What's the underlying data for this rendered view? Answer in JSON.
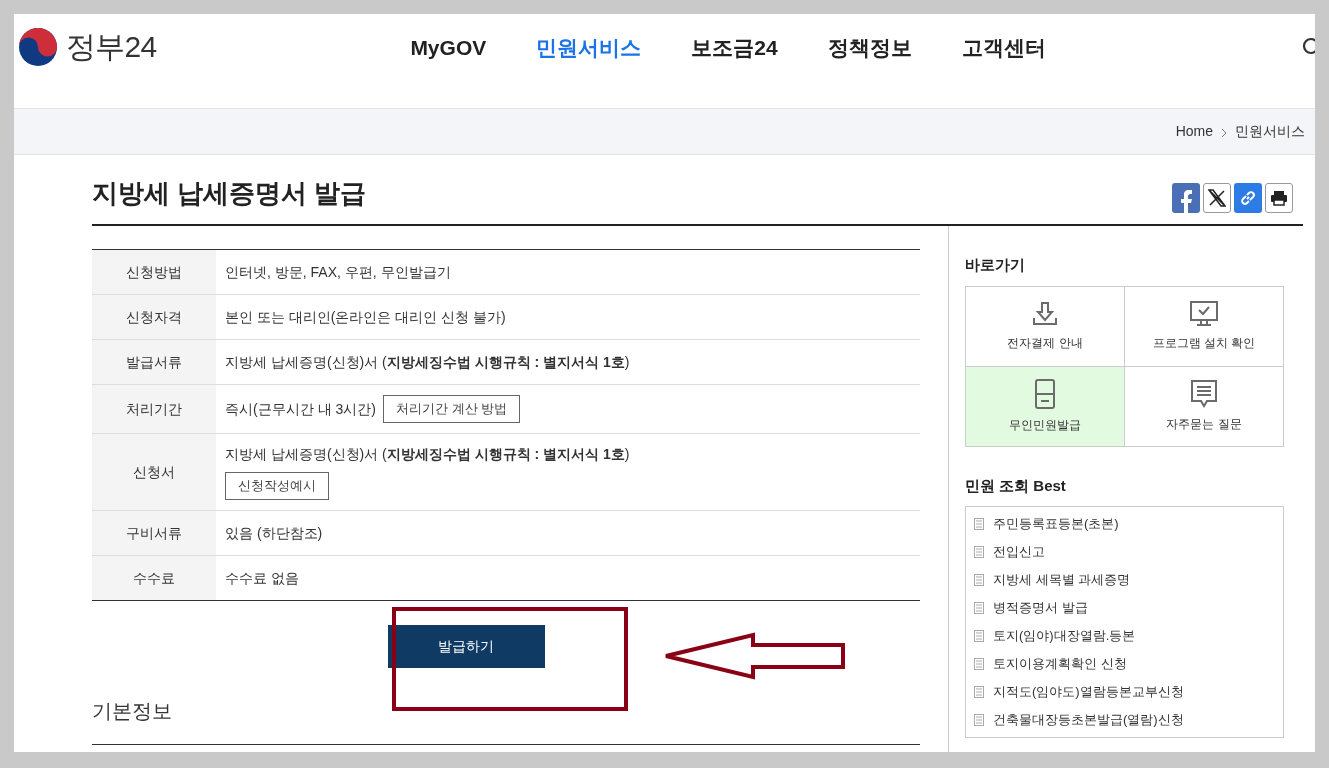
{
  "logo": {
    "text": "정부24"
  },
  "nav": [
    {
      "label": "MyGOV",
      "selected": false
    },
    {
      "label": "민원서비스",
      "selected": true
    },
    {
      "label": "보조금24",
      "selected": false
    },
    {
      "label": "정책정보",
      "selected": false
    },
    {
      "label": "고객센터",
      "selected": false
    }
  ],
  "breadcrumb": [
    "Home",
    "민원서비스"
  ],
  "page_title": "지방세 납세증명서 발급",
  "info_rows": [
    {
      "label": "신청방법",
      "value": "인터넷, 방문, FAX, 우편, 무인발급기"
    },
    {
      "label": "신청자격",
      "value": "본인 또는 대리인(온라인은 대리인 신청 불가)"
    },
    {
      "label": "발급서류",
      "value": "지방세 납세증명(신청)서 (**지방세징수법 시행규칙 : 별지서식 1호**)"
    },
    {
      "label": "처리기간",
      "value": "즉시(근무시간 내 3시간)",
      "button": "처리기간 계산 방법",
      "button_below": false
    },
    {
      "label": "신청서",
      "value": "지방세 납세증명(신청)서 (**지방세징수법 시행규칙 : 별지서식 1호**)",
      "button": "신청작성예시",
      "button_below": true
    },
    {
      "label": "구비서류",
      "value": "있음 (하단참조)"
    },
    {
      "label": "수수료",
      "value": "수수료 없음"
    }
  ],
  "issue_button": "발급하기",
  "section_title": "기본정보",
  "shortcuts": {
    "title": "바로가기",
    "items": [
      {
        "label": "전자결제 안내",
        "kind": "download",
        "selected": false
      },
      {
        "label": "프로그램 설치 확인",
        "kind": "monitor",
        "selected": false
      },
      {
        "label": "무인민원발급",
        "kind": "kiosk",
        "selected": true
      },
      {
        "label": "자주묻는 질문",
        "kind": "chat",
        "selected": false
      }
    ]
  },
  "best": {
    "title": "민원 조회 Best",
    "items": [
      "주민등록표등본(초본)",
      "전입신고",
      "지방세 세목별 과세증명",
      "병적증명서 발급",
      "토지(임야)대장열람.등본",
      "토지이용계획확인 신청",
      "지적도(임야도)열람등본교부신청",
      "건축물대장등초본발급(열람)신청"
    ]
  }
}
